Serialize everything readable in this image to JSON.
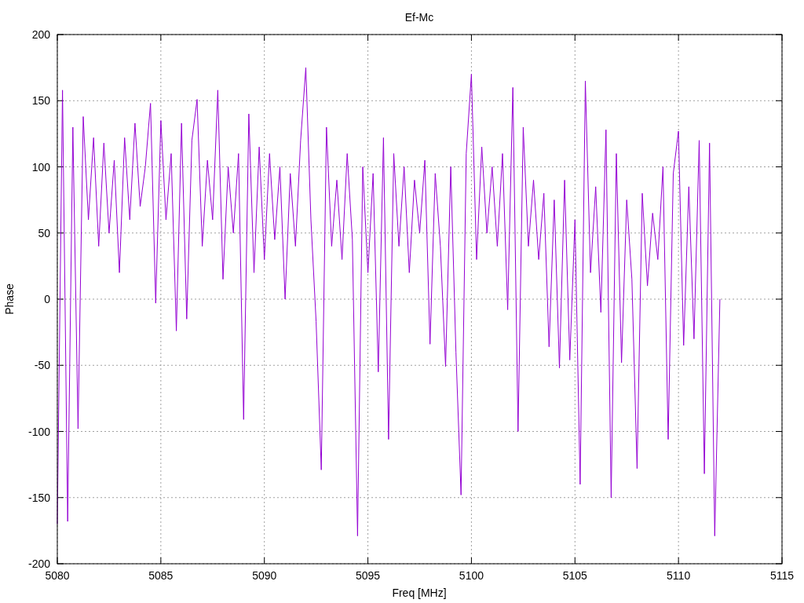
{
  "chart_data": {
    "type": "line",
    "title": "Ef-Mc",
    "xlabel": "Freq [MHz]",
    "ylabel": "Phase",
    "xlim": [
      5080,
      5115
    ],
    "grid": true,
    "ylim": [
      -200,
      200
    ],
    "xticks": [
      5080,
      5085,
      5090,
      5095,
      5100,
      5105,
      5110,
      5115
    ],
    "yticks": [
      -200,
      -150,
      -100,
      -50,
      0,
      50,
      100,
      150,
      200
    ],
    "x": [
      5080,
      5080.25,
      5080.5,
      5080.75,
      5081,
      5081.25,
      5081.5,
      5081.75,
      5082,
      5082.25,
      5082.5,
      5082.75,
      5083,
      5083.25,
      5083.5,
      5083.75,
      5084,
      5084.25,
      5084.5,
      5084.75,
      5085,
      5085.25,
      5085.5,
      5085.75,
      5086,
      5086.25,
      5086.5,
      5086.75,
      5087,
      5087.25,
      5087.5,
      5087.75,
      5088,
      5088.25,
      5088.5,
      5088.75,
      5089,
      5089.25,
      5089.5,
      5089.75,
      5090,
      5090.25,
      5090.5,
      5090.75,
      5091,
      5091.25,
      5091.5,
      5091.75,
      5092,
      5092.25,
      5092.5,
      5092.75,
      5093,
      5093.25,
      5093.5,
      5093.75,
      5094,
      5094.25,
      5094.5,
      5094.75,
      5095,
      5095.25,
      5095.5,
      5095.75,
      5096,
      5096.25,
      5096.5,
      5096.75,
      5097,
      5097.25,
      5097.5,
      5097.75,
      5098,
      5098.25,
      5098.5,
      5098.75,
      5099,
      5099.25,
      5099.5,
      5099.75,
      5100,
      5100.25,
      5100.5,
      5100.75,
      5101,
      5101.25,
      5101.5,
      5101.75,
      5102,
      5102.25,
      5102.5,
      5102.75,
      5103,
      5103.25,
      5103.5,
      5103.75,
      5104,
      5104.25,
      5104.5,
      5104.75,
      5105,
      5105.25,
      5105.5,
      5105.75,
      5106,
      5106.25,
      5106.5,
      5106.75,
      5107,
      5107.25,
      5107.5,
      5107.75,
      5108,
      5108.25,
      5108.5,
      5108.75,
      5109,
      5109.25,
      5109.5,
      5109.75,
      5110,
      5110.25,
      5110.5,
      5110.75,
      5111,
      5111.25,
      5111.5,
      5111.75,
      5112
    ],
    "series": [
      {
        "color": "#9400d3",
        "values": [
          -170,
          158,
          -168,
          130,
          -98,
          138,
          60,
          122,
          40,
          118,
          50,
          105,
          20,
          122,
          60,
          133,
          70,
          100,
          148,
          -3,
          135,
          60,
          110,
          -24,
          133,
          -15,
          120,
          151,
          40,
          105,
          60,
          158,
          15,
          100,
          50,
          110,
          -91,
          140,
          20,
          115,
          30,
          110,
          45,
          100,
          0,
          95,
          40,
          120,
          175,
          60,
          -17,
          -129,
          130,
          40,
          90,
          30,
          110,
          45,
          -179,
          100,
          20,
          95,
          -55,
          122,
          -106,
          110,
          40,
          100,
          20,
          90,
          50,
          105,
          -34,
          95,
          40,
          -51,
          100,
          -40,
          -148,
          110,
          170,
          30,
          115,
          50,
          100,
          40,
          110,
          -8,
          160,
          -100,
          130,
          40,
          90,
          30,
          80,
          -36,
          75,
          -52,
          90,
          -46,
          60,
          -140,
          165,
          20,
          85,
          -10,
          128,
          -150,
          110,
          -48,
          75,
          15,
          -128,
          80,
          10,
          65,
          30,
          100,
          -106,
          95,
          127,
          -35,
          85,
          -30,
          120,
          -132,
          118,
          -179,
          0
        ]
      }
    ]
  }
}
